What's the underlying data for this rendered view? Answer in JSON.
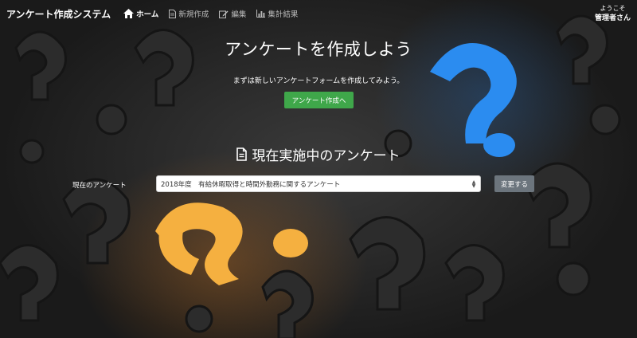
{
  "navbar": {
    "brand": "アンケート作成システム",
    "items": [
      {
        "label": "ホーム",
        "icon": "home-icon",
        "active": true
      },
      {
        "label": "新規作成",
        "icon": "document-icon",
        "active": false
      },
      {
        "label": "編集",
        "icon": "edit-icon",
        "active": false
      },
      {
        "label": "集計結果",
        "icon": "bar-chart-icon",
        "active": false
      }
    ],
    "welcome": "ようこそ",
    "user_name": "管理者さん"
  },
  "hero": {
    "title": "アンケートを作成しよう",
    "subtitle": "まずは新しいアンケートフォームを作成してみよう。",
    "create_button": "アンケート作成へ"
  },
  "current": {
    "section_title": "現在実施中のアンケート",
    "label": "現在のアンケート",
    "selected": "2018年度　有給休暇取得と時間外勤務に関するアンケート",
    "change_button": "変更する"
  },
  "colors": {
    "primary_button": "#3fa74a",
    "secondary_button": "#6c757d",
    "orange_accent": "#f5b040",
    "blue_accent": "#2b8cf0"
  }
}
